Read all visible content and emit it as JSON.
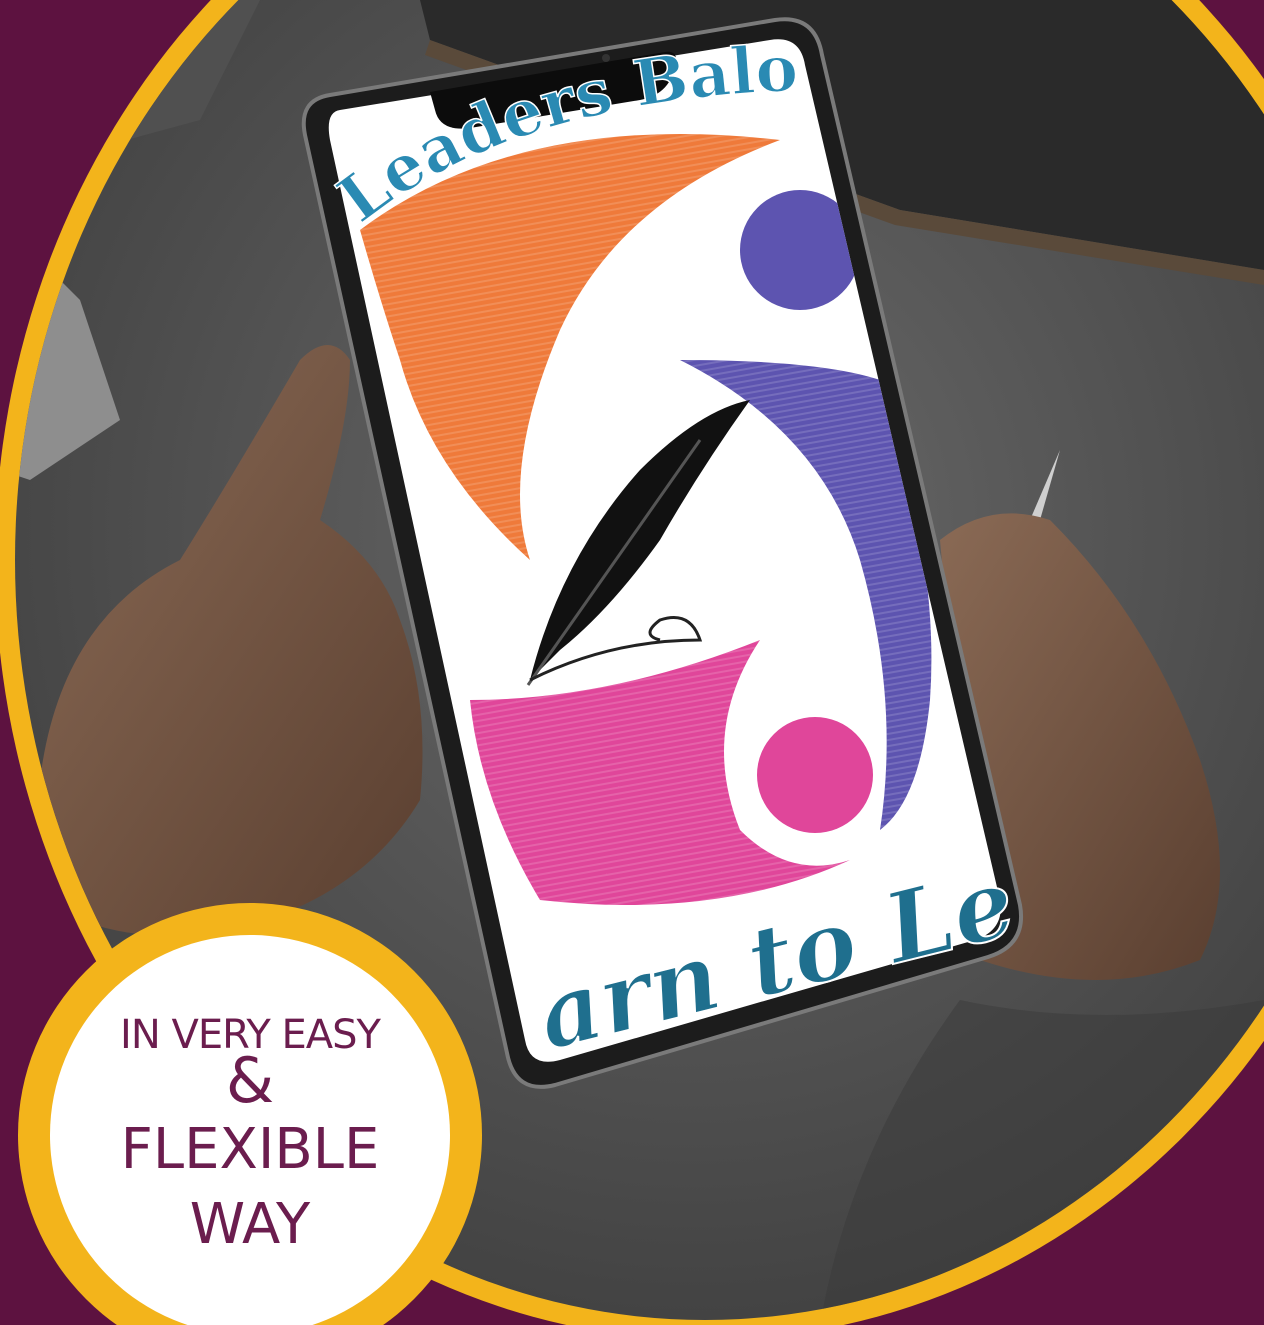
{
  "logo": {
    "top_text": "Leaders Balo",
    "bottom_text": "arn to Le"
  },
  "badge": {
    "line1": "IN VERY EASY",
    "ampersand": "&",
    "line2": "FLEXIBLE",
    "line3": "WAY"
  },
  "colors": {
    "frame_purple": "#5d1240",
    "ring_yellow": "#f3b41b",
    "badge_white": "#ffffff",
    "badge_text": "#6b1d4e",
    "logo_orange": "#ef7a3a",
    "logo_purple": "#5d54b0",
    "logo_pink": "#e0469a",
    "logo_text_teal": "#2a8ab3"
  },
  "icons": [
    "feather-pen-icon"
  ]
}
